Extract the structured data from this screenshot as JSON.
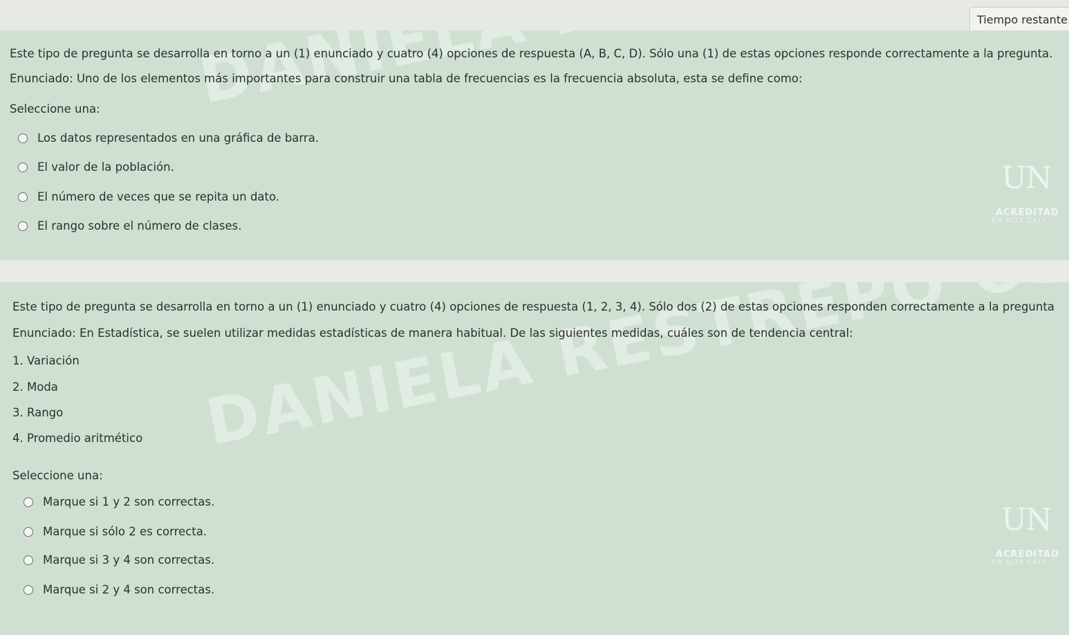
{
  "timer": {
    "label": "Tiempo restante"
  },
  "question1": {
    "instruction": "Este tipo de pregunta se desarrolla en torno a un (1) enunciado y cuatro (4) opciones de respuesta (A, B, C, D). Sólo una (1) de estas opciones responde correctamente a la pregunta.",
    "statement": "Enunciado: Uno de los elementos más importantes para construir una tabla de frecuencias es la frecuencia absoluta, esta se define como:",
    "select_label": "Seleccione una:",
    "options": [
      "Los datos representados en una gráfica de barra.",
      "El valor de la población.",
      "El número de veces que se repita un dato.",
      "El rango sobre el número de clases."
    ]
  },
  "question2": {
    "instruction": "Este tipo de pregunta se desarrolla en torno a un (1) enunciado y cuatro (4) opciones de respuesta (1, 2, 3, 4). Sólo dos (2) de estas opciones responden correctamente a la pregunta",
    "statement": "Enunciado: En Estadística, se suelen utilizar medidas estadísticas de manera habitual. De las siguientes medidas, cuáles son de tendencia central:",
    "items": [
      "1. Variación",
      "2. Moda",
      "3. Rango",
      "4. Promedio aritmético"
    ],
    "select_label": "Seleccione una:",
    "options": [
      "Marque si 1 y 2 son correctas.",
      "Marque si sólo 2 es correcta.",
      "Marque si 3 y 4 son correctas.",
      "Marque si 2 y 4 son correctas."
    ]
  },
  "watermark": {
    "text": "DANIELA RESTREPO OSORIO"
  },
  "logo": {
    "mark": "UN",
    "caption": "ACREDITAD",
    "caption2": "EN ALTA CALI"
  }
}
